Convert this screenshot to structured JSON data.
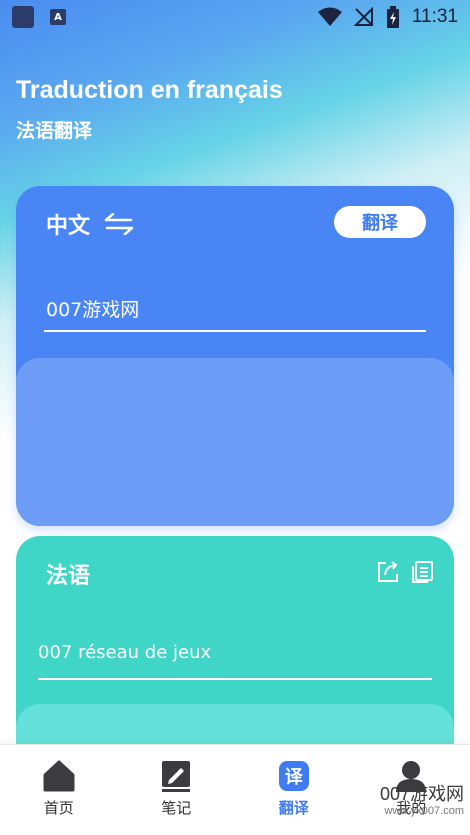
{
  "status_bar": {
    "time": "11:31",
    "a_badge": "A"
  },
  "header": {
    "title_en": "Traduction en français",
    "title_cn": "法语翻译"
  },
  "source_card": {
    "language": "中文",
    "translate_label": "翻译",
    "input_value": "007游戏网"
  },
  "target_card": {
    "language": "法语",
    "result_text": "007 réseau de jeux"
  },
  "bottom_nav": {
    "items": [
      {
        "label": "首页",
        "icon": "home-icon"
      },
      {
        "label": "笔记",
        "icon": "note-icon"
      },
      {
        "label": "翻译",
        "icon": "translate-icon",
        "glyph": "译",
        "active": true
      },
      {
        "label": "我的",
        "icon": "user-icon"
      }
    ]
  },
  "watermark": {
    "main": "007游戏网",
    "sub": "www.yx007.com"
  },
  "colors": {
    "primary": "#4a85f5",
    "teal": "#3fd6c8",
    "active": "#3f7cf2"
  }
}
